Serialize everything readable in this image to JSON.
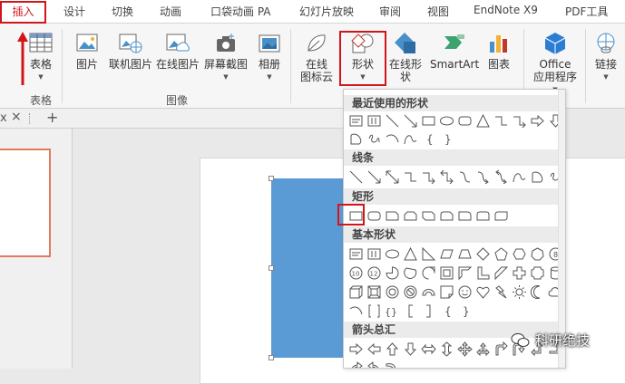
{
  "tabs": {
    "insert": "插入",
    "items": [
      "设计",
      "切换",
      "动画",
      "口袋动画 PA",
      "幻灯片放映",
      "审阅",
      "视图",
      "EndNote X9",
      "PDF工具"
    ]
  },
  "ribbon": {
    "table_label": "表格",
    "table_group": "表格",
    "picture": "图片",
    "online_picture": "联机图片",
    "online_pic2": "在线图片",
    "screenshot": "屏幕截图",
    "album": "相册",
    "image_group": "图像",
    "cloud_line1": "在线",
    "cloud_line2": "图标云",
    "shapes": "形状",
    "online_shapes": "在线形状",
    "smartart": "SmartArt",
    "chart": "图表",
    "office_line1": "Office",
    "office_line2": "应用程序",
    "link": "链接"
  },
  "doc_tab": {
    "close": "×",
    "add": "+"
  },
  "shapes_panel": {
    "recent": "最近使用的形状",
    "lines": "线条",
    "rectangles": "矩形",
    "basic": "基本形状",
    "arrows": "箭头总汇"
  },
  "watermark": {
    "text": "科研绝技"
  },
  "colors": {
    "accent_red": "#d0161b",
    "shape_blue": "#5b9bd5",
    "thumb_border": "#e07a5f"
  }
}
